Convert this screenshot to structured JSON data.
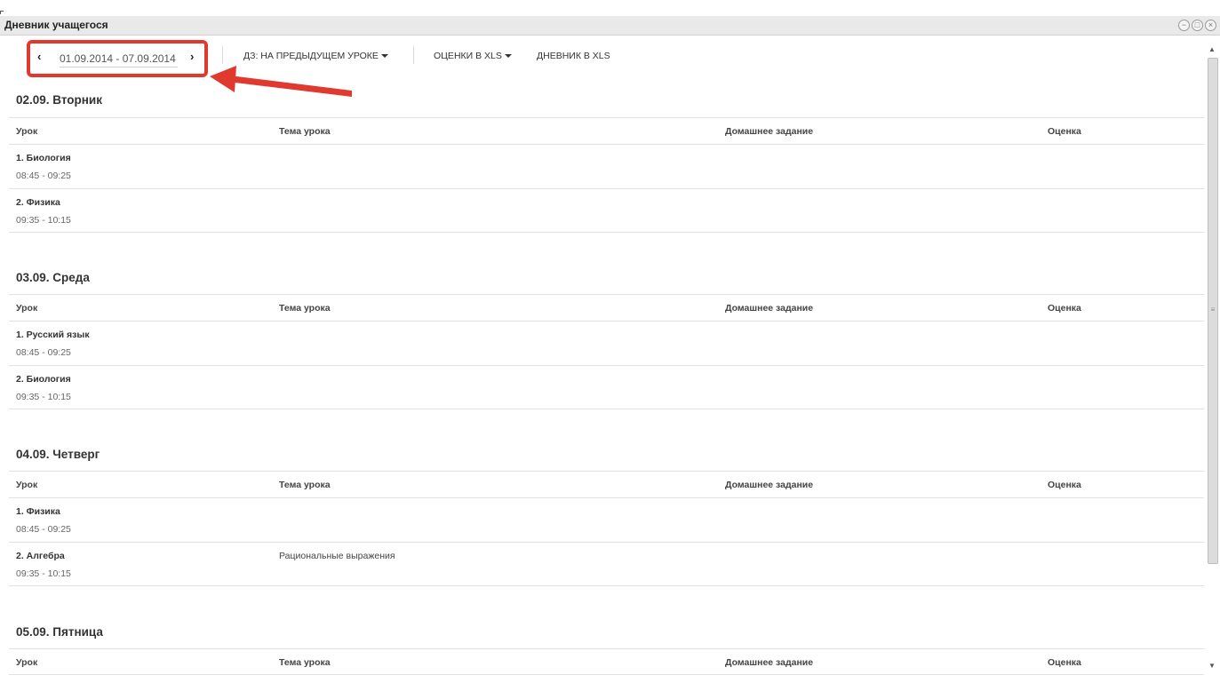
{
  "window": {
    "title": "Дневник учащегося",
    "controls": [
      "minimize-icon",
      "maximize-icon",
      "close-icon"
    ]
  },
  "toolbar": {
    "prev_icon": "‹",
    "next_icon": "›",
    "date_range": "01.09.2014 - 07.09.2014",
    "homework_mode": "ДЗ: НА ПРЕДЫДУЩЕМ УРОКЕ",
    "grades_xls": "ОЦЕНКИ В XLS",
    "diary_xls": "ДНЕВНИК В XLS"
  },
  "annotation": {
    "highlight_color": "#e03a2f"
  },
  "columns": {
    "lesson": "Урок",
    "topic": "Тема урока",
    "homework": "Домашнее задание",
    "grade": "Оценка"
  },
  "days": [
    {
      "title": "02.09. Вторник",
      "lessons": [
        {
          "name": "1. Биология",
          "time": "08:45 - 09:25",
          "topic": "",
          "homework": "",
          "grade": ""
        },
        {
          "name": "2. Физика",
          "time": "09:35 - 10:15",
          "topic": "",
          "homework": "",
          "grade": ""
        }
      ]
    },
    {
      "title": "03.09. Среда",
      "lessons": [
        {
          "name": "1. Русский язык",
          "time": "08:45 - 09:25",
          "topic": "",
          "homework": "",
          "grade": ""
        },
        {
          "name": "2. Биология",
          "time": "09:35 - 10:15",
          "topic": "",
          "homework": "",
          "grade": ""
        }
      ]
    },
    {
      "title": "04.09. Четверг",
      "lessons": [
        {
          "name": "1. Физика",
          "time": "08:45 - 09:25",
          "topic": "",
          "homework": "",
          "grade": ""
        },
        {
          "name": "2. Алгебра",
          "time": "09:35 - 10:15",
          "topic": "Рациональные выражения",
          "homework": "",
          "grade": ""
        }
      ]
    },
    {
      "title": "05.09. Пятница",
      "lessons": []
    }
  ]
}
